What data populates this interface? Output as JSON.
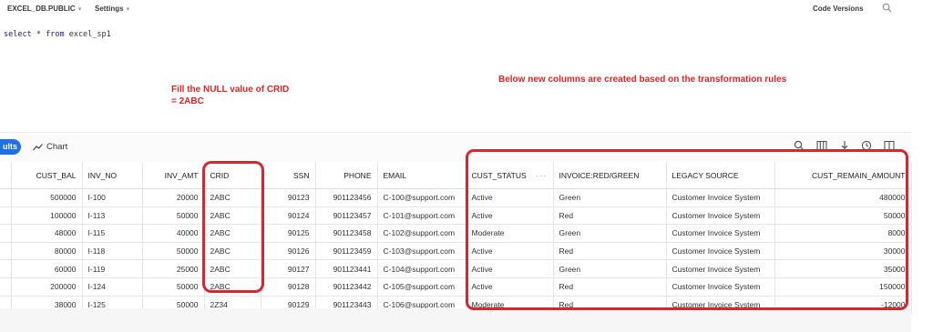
{
  "topbar": {
    "database": "EXCEL_DB.PUBLIC",
    "settings": "Settings",
    "caret": "▾",
    "code_versions": "Code Versions"
  },
  "editor": {
    "keyword_select": "select",
    "star": "*",
    "keyword_from": "from",
    "table": "excel_sp1"
  },
  "annotations": {
    "left_line1": "Fill the NULL value of CRID",
    "left_line2": "= 2ABC",
    "right": "Below new columns are created based on the transformation rules"
  },
  "results_bar": {
    "results_tab": "ults",
    "chart_tab": "Chart"
  },
  "table": {
    "columns": [
      "CUST_BAL",
      "INV_NO",
      "INV_AMT",
      "CRID",
      "SSN",
      "PHONE",
      "EMAIL",
      "CUST_STATUS",
      "INVOICE:RED/GREEN",
      "LEGACY SOURCE",
      "CUST_REMAIN_AMOUNT"
    ],
    "column_menu": "···",
    "rows": [
      [
        "500000",
        "I-100",
        "20000",
        "2ABC",
        "90123",
        "901123456",
        "C-100@support.com",
        "Active",
        "Green",
        "Customer Invoice System",
        "480000"
      ],
      [
        "100000",
        "I-113",
        "50000",
        "2ABC",
        "90124",
        "901123457",
        "C-101@support.com",
        "Active",
        "Red",
        "Customer Invoice System",
        "50000"
      ],
      [
        "48000",
        "I-115",
        "40000",
        "2ABC",
        "90125",
        "901123458",
        "C-102@support.com",
        "Moderate",
        "Green",
        "Customer Invoice System",
        "8000"
      ],
      [
        "80000",
        "I-118",
        "50000",
        "2ABC",
        "90126",
        "901123459",
        "C-103@support.com",
        "Active",
        "Red",
        "Customer Invoice System",
        "30000"
      ],
      [
        "60000",
        "I-119",
        "25000",
        "2ABC",
        "90127",
        "901123441",
        "C-104@support.com",
        "Active",
        "Green",
        "Customer Invoice System",
        "35000"
      ],
      [
        "200000",
        "I-124",
        "50000",
        "2ABC",
        "90128",
        "901123442",
        "C-105@support.com",
        "Active",
        "Red",
        "Customer Invoice System",
        "150000"
      ],
      [
        "38000",
        "I-125",
        "50000",
        "2Z34",
        "90129",
        "901123443",
        "C-106@support.com",
        "Moderate",
        "Red",
        "Customer Invoice System",
        "-12000"
      ]
    ]
  },
  "colors": {
    "accent": "#1f6fe5",
    "annotation": "#e02424",
    "highlight_box": "#d6262f",
    "sql_keyword": "#1a1a8c"
  }
}
